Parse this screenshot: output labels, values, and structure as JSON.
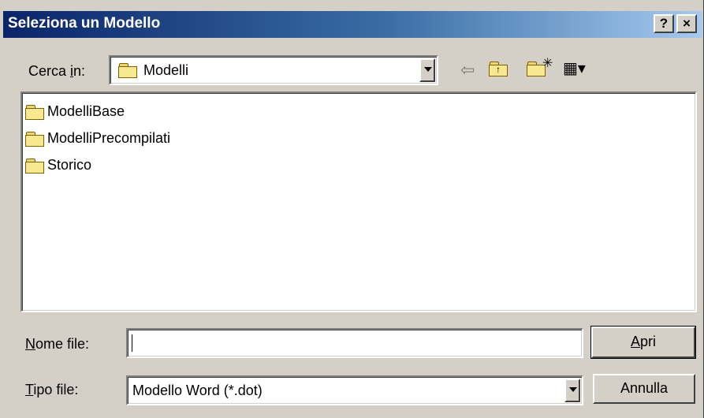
{
  "window": {
    "title": "Seleziona un Modello",
    "help_button": "?",
    "close_button": "×"
  },
  "lookin": {
    "label_prefix": "Cerca ",
    "label_access": "i",
    "label_suffix": "n:",
    "value": "Modelli",
    "folder_icon": "folder-icon"
  },
  "toolbar": {
    "back_icon": "back-arrow-icon",
    "up_icon": "up-folder-icon",
    "new_folder_icon": "new-folder-icon",
    "view_menu_icon": "view-menu-icon"
  },
  "files": [
    {
      "name": "ModelliBase",
      "icon": "folder-icon"
    },
    {
      "name": "ModelliPrecompilati",
      "icon": "folder-icon"
    },
    {
      "name": "Storico",
      "icon": "folder-icon"
    }
  ],
  "filename": {
    "label_access": "N",
    "label_rest": "ome file:",
    "value": ""
  },
  "filetype": {
    "label_access": "T",
    "label_rest": "ipo file:",
    "value": "Modello Word (*.dot)"
  },
  "buttons": {
    "open_access": "A",
    "open_rest": "pri",
    "cancel": "Annulla"
  },
  "colors": {
    "titlebar_start": "#0a246a",
    "titlebar_end": "#a6caf0",
    "dialog_face": "#d4d0c8"
  }
}
